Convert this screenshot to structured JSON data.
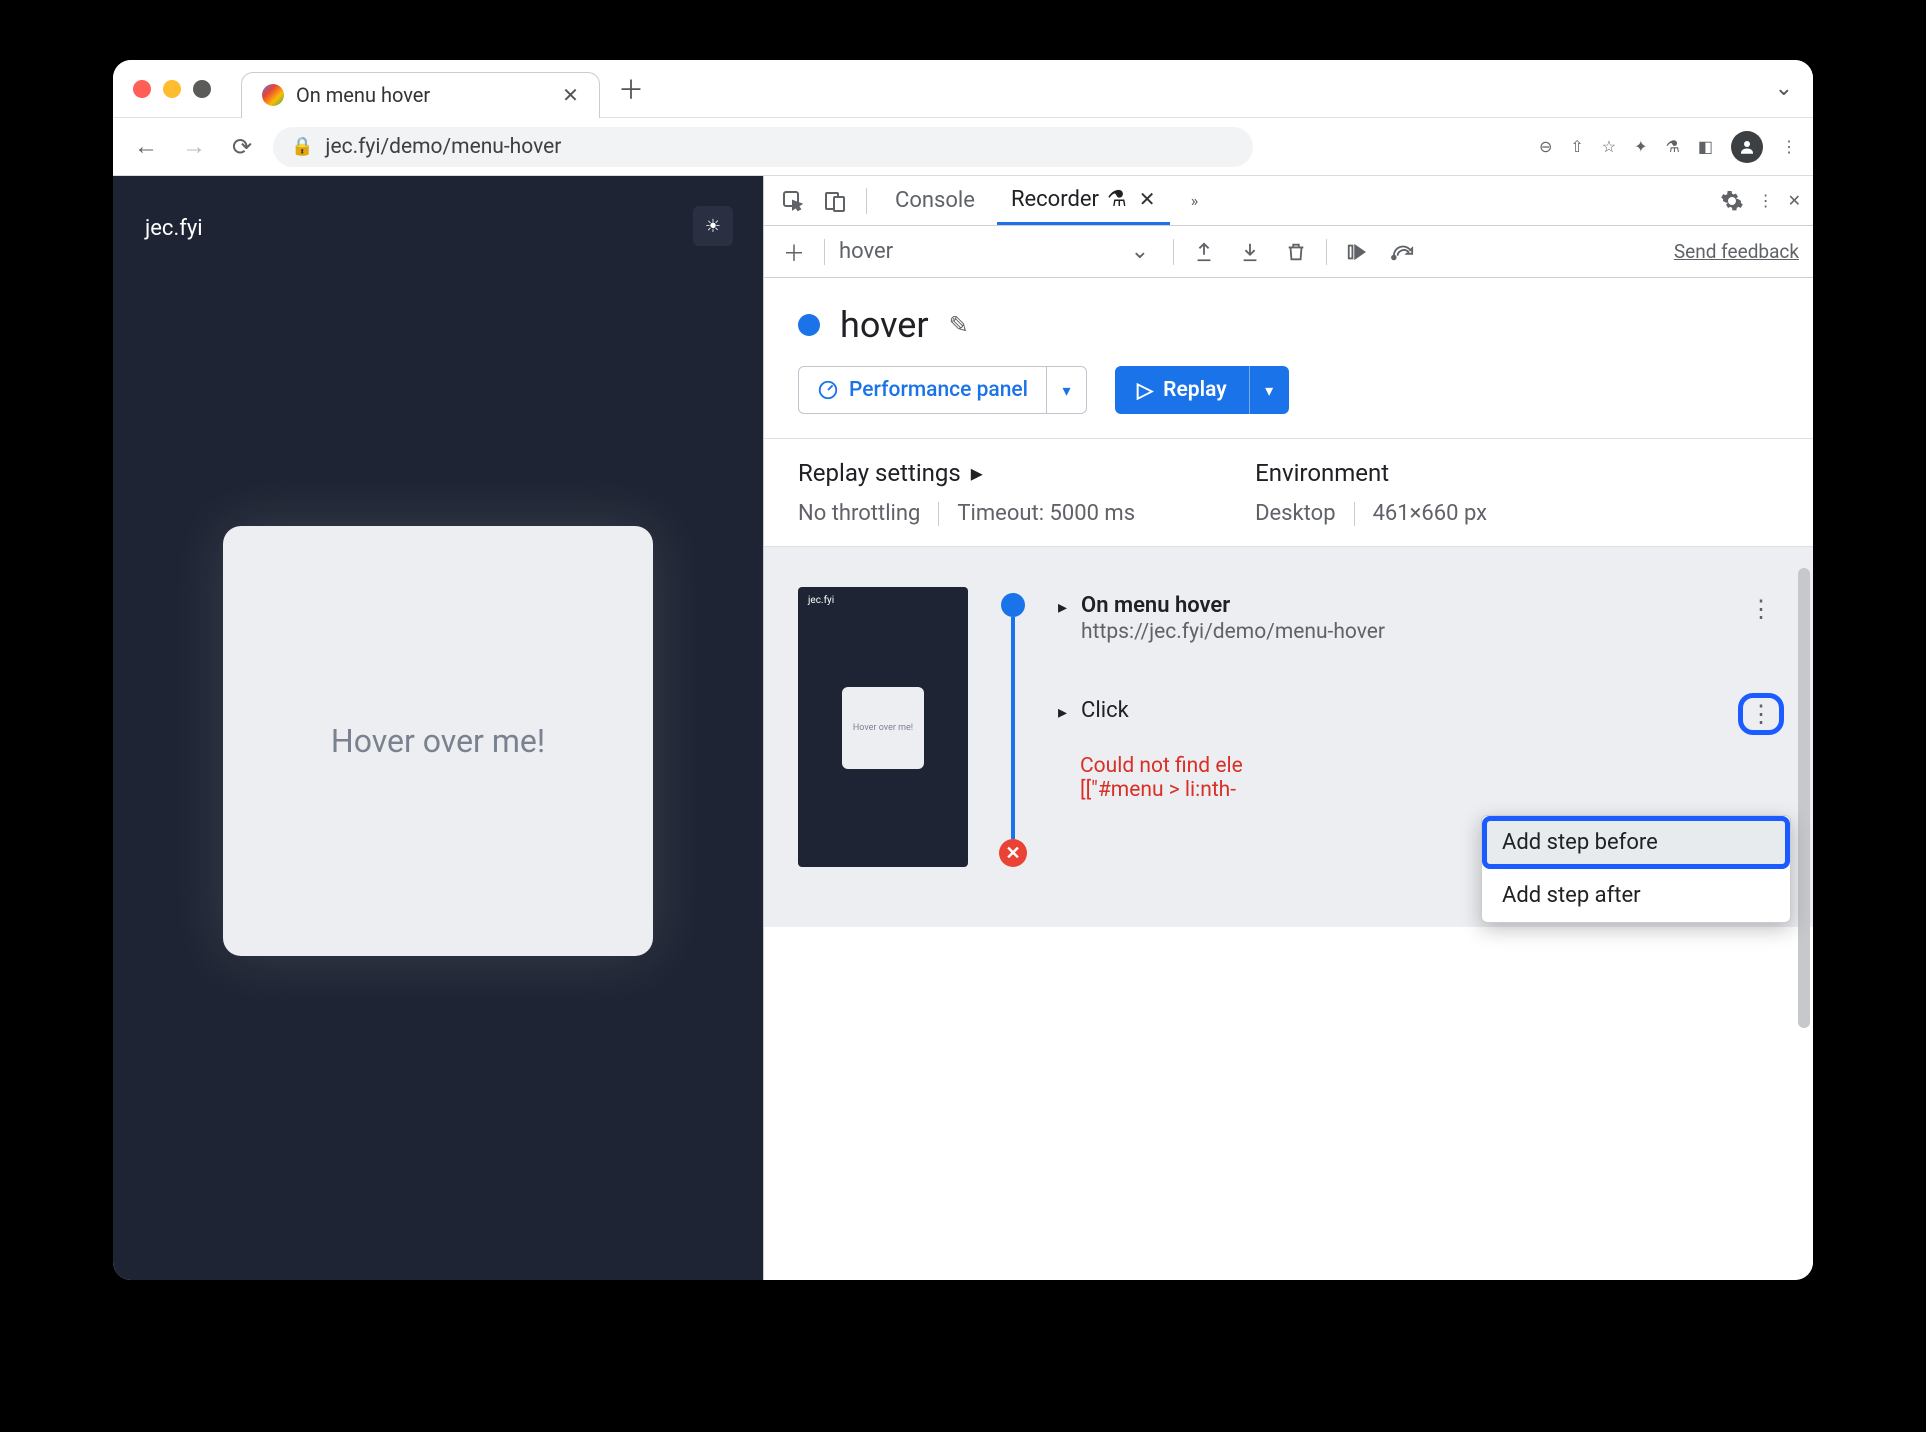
{
  "browser": {
    "tab_title": "On menu hover",
    "url_display": "jec.fyi/demo/menu-hover"
  },
  "page": {
    "brand": "jec.fyi",
    "card_text": "Hover over me!"
  },
  "devtools": {
    "tabs": {
      "console": "Console",
      "recorder": "Recorder"
    },
    "recorder_toolbar": {
      "recording_select": "hover",
      "feedback": "Send feedback"
    },
    "recording": {
      "title": "hover",
      "perf_button": "Performance panel",
      "replay_button": "Replay"
    },
    "settings": {
      "replay_heading": "Replay settings",
      "throttling": "No throttling",
      "timeout": "Timeout: 5000 ms",
      "env_heading": "Environment",
      "device": "Desktop",
      "dimensions": "461×660 px"
    },
    "steps": {
      "thumb_text": "Hover over me!",
      "thumb_brand": "jec.fyi",
      "nav_title": "On menu hover",
      "nav_url": "https://jec.fyi/demo/menu-hover",
      "click_title": "Click",
      "error_l1": "Could not find ele",
      "error_l2": "[[\"#menu > li:nth-"
    },
    "menu": {
      "before": "Add step before",
      "after": "Add step after"
    }
  }
}
